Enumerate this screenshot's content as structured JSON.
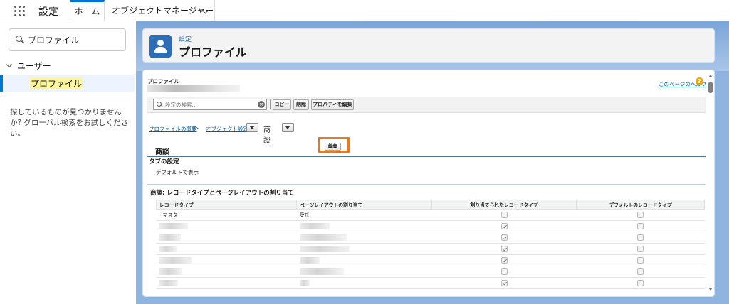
{
  "topbar": {
    "app_title": "設定",
    "tab_home": "ホーム",
    "tab_object_manager": "オブジェクトマネージャー"
  },
  "sidebar": {
    "search_value": "プロファイル",
    "tree_users": "ユーザー",
    "tree_profiles": "プロファイル",
    "help_text": "探しているものが見つかりませんか? グローバル検索をお試しください。"
  },
  "header": {
    "subtitle": "設定",
    "title": "プロファイル"
  },
  "content": {
    "profile_label": "プロファイル",
    "page_help": "このページのヘルプ",
    "help_icon": "?",
    "search_placeholder": "設定の検索...",
    "search_clear": "×",
    "buttons": {
      "copy": "コピー",
      "delete": "削除",
      "edit_properties": "プロパティを編集"
    },
    "breadcrumb": {
      "overview": "プロファイルの概要",
      "sep": ">",
      "object_settings": "オブジェクト設定",
      "current": "商談"
    },
    "section_title": "商談",
    "edit_button": "編集",
    "tab_settings_title": "タブの設定",
    "tab_settings_value": "デフォルトで表示",
    "assign_title": "商談: レコードタイプとページレイアウトの割り当て",
    "table": {
      "headers": [
        "レコードタイプ",
        "ページレイアウトの割り当て",
        "割り当てられたレコードタイプ",
        "デフォルトのレコードタイプ"
      ],
      "first_row": {
        "record_type": "--マスタ--",
        "layout": "受託"
      },
      "assigned_checked": [
        false,
        true,
        true,
        true,
        true,
        false,
        true
      ],
      "default_checked": [
        false,
        false,
        false,
        false,
        false,
        false,
        false
      ]
    }
  },
  "colors": {
    "brand_blue": "#0176d3",
    "header_icon": "#2d6db5",
    "highlight_box": "#ea7a1f",
    "link": "#015ba7"
  }
}
